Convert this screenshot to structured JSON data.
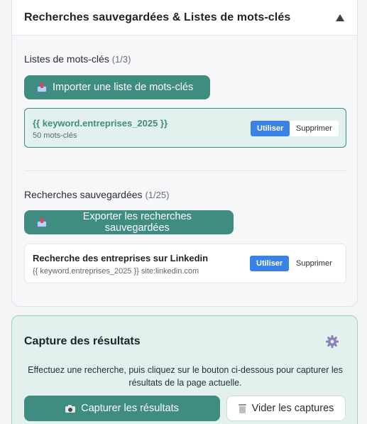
{
  "saved_panel": {
    "title": "Recherches sauvegardées & Listes de mots-clés",
    "keyword_lists": {
      "label": "Listes de mots-clés",
      "count": "(1/3)",
      "import_button": "Importer une liste de mots-clés",
      "items": [
        {
          "name": "{{ keyword.entreprises_2025 }}",
          "count": "50 mots-clés",
          "use_label": "Utiliser",
          "delete_label": "Supprimer"
        }
      ]
    },
    "saved_searches": {
      "label": "Recherches sauvegardées",
      "count": "(1/25)",
      "export_button": "Exporter les recherches sauvegardées",
      "items": [
        {
          "name": "Recherche des entreprises sur Linkedin",
          "query": "{{ keyword.entreprises_2025 }} site:linkedin.com",
          "use_label": "Utiliser",
          "delete_label": "Supprimer"
        }
      ]
    }
  },
  "capture": {
    "title": "Capture des résultats",
    "description": "Effectuez une recherche, puis cliquez sur le bouton ci-dessous pour capturer les résultats de la page actuelle.",
    "capture_button": "Capturer les résultats",
    "clear_button": "Vider les captures"
  },
  "icons": {
    "collapse": "triangle-up-icon",
    "import": "inbox-tray-icon",
    "export": "outbox-tray-icon",
    "settings": "gear-icon",
    "capture": "camera-icon",
    "clear": "wastebasket-icon"
  },
  "colors": {
    "accent": "#3f8c80",
    "accent_light": "#e3f1ee",
    "primary_blue": "#3b82e6"
  }
}
